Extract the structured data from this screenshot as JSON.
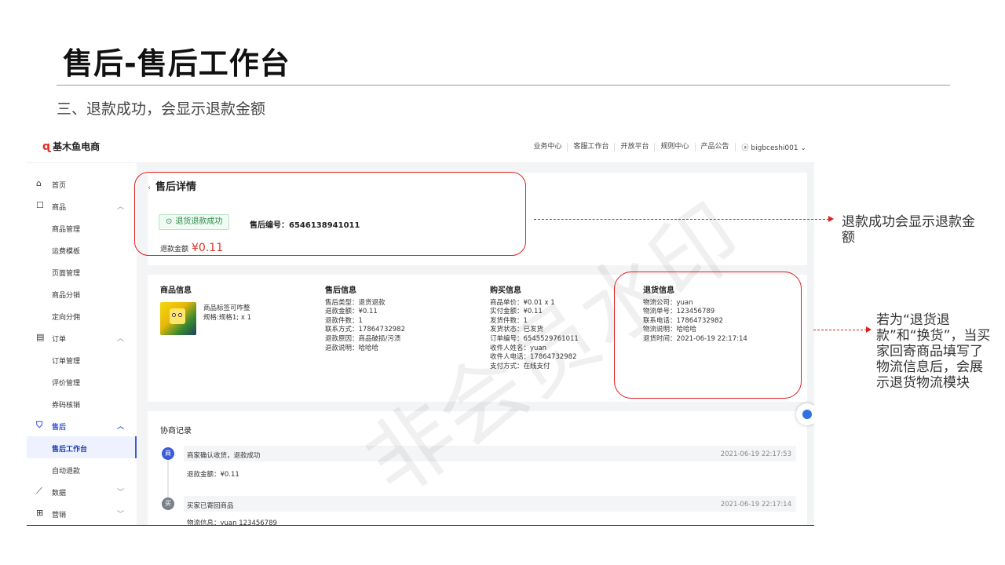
{
  "slide": {
    "title": "售后-售后工作台",
    "subtitle": "三、退款成功，会显示退款金额"
  },
  "app": {
    "logo": "基木鱼电商",
    "top_nav": [
      "业务中心",
      "客服工作台",
      "开放平台",
      "规则中心",
      "产品公告"
    ],
    "user": "bigbceshi001",
    "sidebar": [
      {
        "label": "首页",
        "icon": "home-icon",
        "level": 1
      },
      {
        "label": "商品",
        "icon": "box-icon",
        "level": 1,
        "chevron": "^"
      },
      {
        "label": "商品管理",
        "level": 2
      },
      {
        "label": "运费模板",
        "level": 2
      },
      {
        "label": "页面管理",
        "level": 2
      },
      {
        "label": "商品分销",
        "level": 2
      },
      {
        "label": "定向分佣",
        "level": 2
      },
      {
        "label": "订单",
        "icon": "order-icon",
        "level": 1,
        "chevron": "^"
      },
      {
        "label": "订单管理",
        "level": 2
      },
      {
        "label": "评价管理",
        "level": 2
      },
      {
        "label": "券码核销",
        "level": 2
      },
      {
        "label": "售后",
        "icon": "shield-icon",
        "level": 1,
        "chevron": "^",
        "active": true
      },
      {
        "label": "售后工作台",
        "level": 2,
        "selected": true
      },
      {
        "label": "自动退款",
        "level": 2
      },
      {
        "label": "数据",
        "icon": "chart-icon",
        "level": 1,
        "chevron": "v"
      },
      {
        "label": "营销",
        "icon": "gift-icon",
        "level": 1,
        "chevron": "v"
      }
    ],
    "detail": {
      "page_title": "售后详情",
      "status": "退货退款成功",
      "aftersale_no": "售后编号：6546138941011",
      "refund_label": "退款金额",
      "refund_amount": "¥0.11"
    },
    "product": {
      "header": "商品信息",
      "name": "商品标签可咋整",
      "spec": "规格:规格1; x 1"
    },
    "aftersale_info": {
      "header": "售后信息",
      "lines": [
        "售后类型：退货退款",
        "退款金额：¥0.11",
        "退款件数：1",
        "联系方式：17864732982",
        "退款原因：商品破损/污渍",
        "退款说明：哈哈哈"
      ]
    },
    "purchase_info": {
      "header": "购买信息",
      "lines": [
        "商品单价：¥0.01 x 1",
        "实付金额：¥0.11",
        "发货件数：1",
        "发货状态：已发货",
        "订单编号：6545529761011",
        "收件人姓名：yuan",
        "收件人电话：17864732982",
        "支付方式：在线支付"
      ]
    },
    "return_info": {
      "header": "退货信息",
      "lines": [
        "物流公司：yuan",
        "物流单号：123456789",
        "联系电话：17864732982",
        "物流说明：哈哈哈",
        "退货时间：2021-06-19 22:17:14"
      ]
    },
    "negotiation": {
      "title": "协商记录",
      "records": [
        {
          "avatar": "商",
          "text": "商家确认收货，退款成功",
          "time": "2021-06-19 22:17:53",
          "detail": "退款金额：¥0.11"
        },
        {
          "avatar": "买",
          "text": "买家已寄回商品",
          "time": "2021-06-19 22:17:14",
          "detail": "物流信息：yuan 123456789"
        }
      ]
    },
    "watermark": "非会员水印"
  },
  "annotations": {
    "note1": "退款成功会显示退款金额",
    "note2": "若为“退货退款”和“换货”，当买家回寄商品填写了物流信息后，会展示退货物流模块",
    "highlight_color": "#e02020"
  }
}
